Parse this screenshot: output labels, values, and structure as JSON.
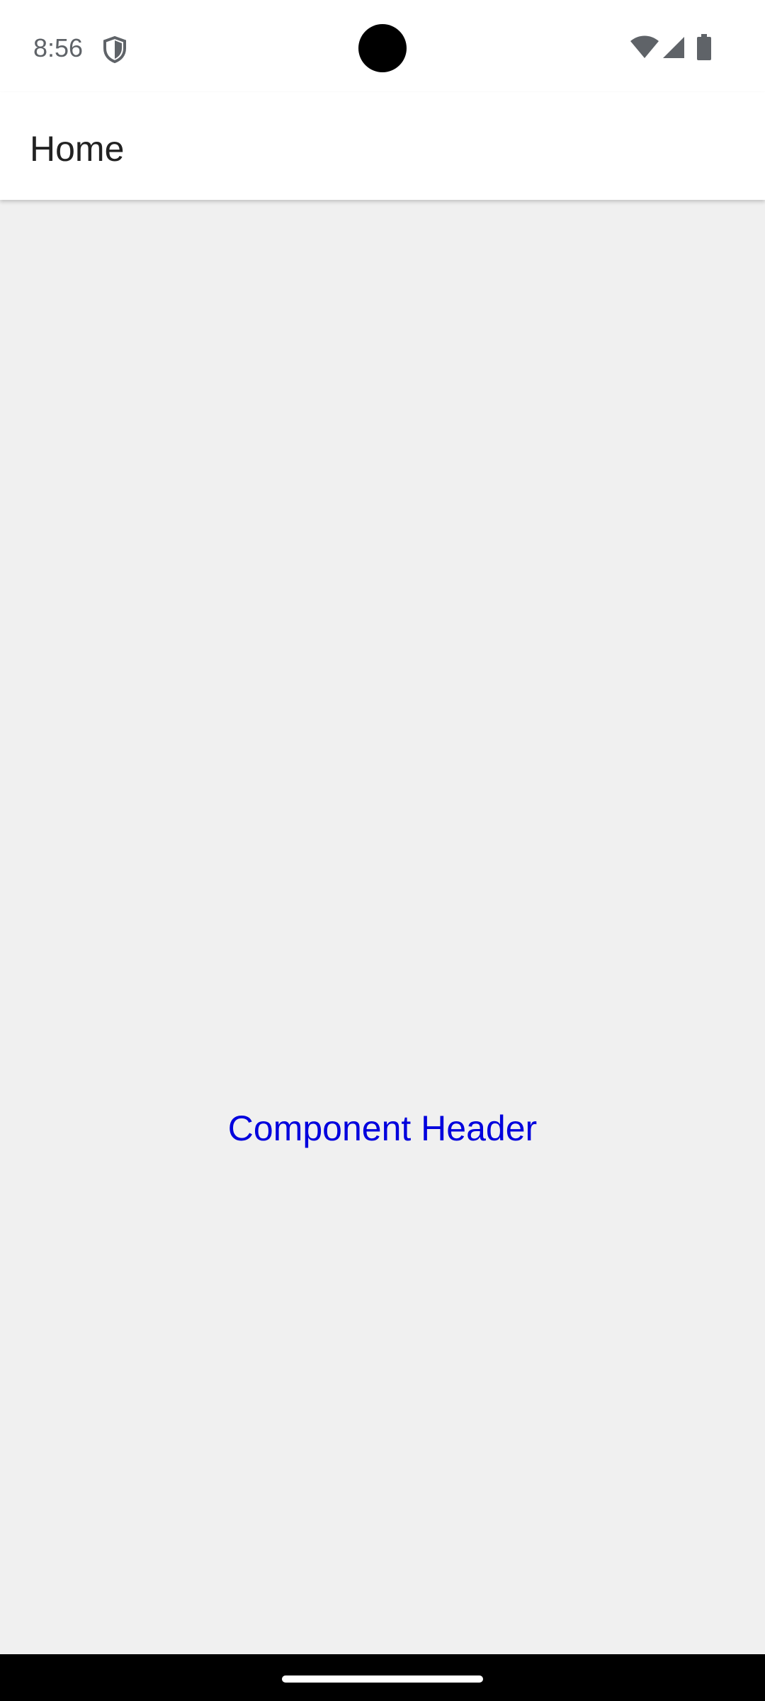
{
  "status_bar": {
    "time": "8:56",
    "icons": [
      "shield-icon",
      "wifi-icon",
      "signal-icon",
      "battery-icon"
    ]
  },
  "app_bar": {
    "title": "Home"
  },
  "main": {
    "component_header": "Component Header"
  },
  "colors": {
    "app_bar_background": "#ffffff",
    "content_background": "#f0f0f0",
    "header_text": "#0000dd",
    "navigation_bar": "#000000"
  }
}
